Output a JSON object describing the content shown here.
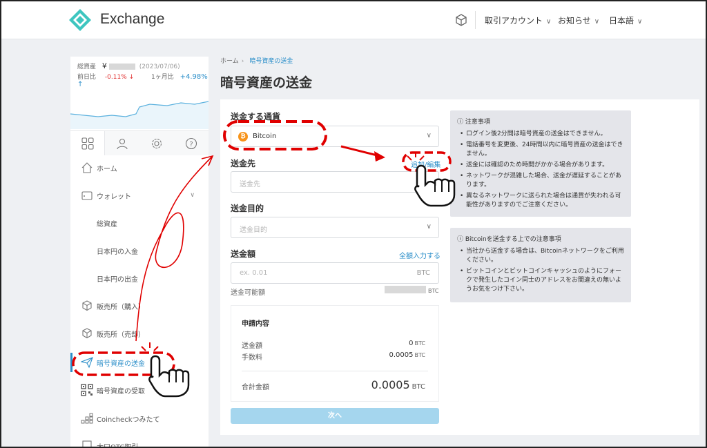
{
  "header": {
    "app_name": "Exchange",
    "menu": [
      {
        "label": "取引アカウント"
      },
      {
        "label": "お知らせ"
      },
      {
        "label": "日本語"
      }
    ],
    "brand_color": "#3fc6c0"
  },
  "sidebar": {
    "balance_label": "総資産",
    "currency_symbol": "¥",
    "balance_date": "(2023/07/06)",
    "prev_day_label": "前日比",
    "prev_day_value": "-0.11% ↓",
    "month_label": "1ヶ月比",
    "month_value": "+4.98% ↑",
    "items": [
      {
        "label": "ホーム"
      },
      {
        "label": "ウォレット"
      },
      {
        "label": "総資産"
      },
      {
        "label": "日本円の入金"
      },
      {
        "label": "日本円の出金"
      },
      {
        "label": "販売所（購入）"
      },
      {
        "label": "販売所（売却）"
      },
      {
        "label": "暗号資産の送金"
      },
      {
        "label": "暗号資産の受取"
      },
      {
        "label": "Coincheckつみたて"
      },
      {
        "label": "大口OTC取引"
      }
    ]
  },
  "breadcrumb": {
    "home": "ホーム",
    "sep": "›",
    "current": "暗号資産の送金"
  },
  "page_title": "暗号資産の送金",
  "form": {
    "currency_label": "送金する通貨",
    "currency_value": "Bitcoin",
    "dest_label": "送金先",
    "dest_link": "追加/編集",
    "dest_placeholder": "送金先",
    "purpose_label": "送金目的",
    "purpose_placeholder": "送金目的",
    "amount_label": "送金額",
    "amount_link": "全額入力する",
    "amount_placeholder": "ex. 0.01",
    "amount_unit": "BTC",
    "available_label": "送金可能額",
    "available_unit": "BTC"
  },
  "summary": {
    "title": "申請内容",
    "amount_label": "送金額",
    "amount_value": "0",
    "fee_label": "手数料",
    "fee_value": "0.0005",
    "total_label": "合計金額",
    "total_value": "0.0005",
    "unit": "BTC"
  },
  "next_button": "次へ",
  "notice1": {
    "title": "ⓘ 注意事項",
    "items": [
      "ログイン後2分間は暗号資産の送金はできません。",
      "電話番号を変更後、24時間以内に暗号資産の送金はできません。",
      "送金には確認のため時間がかかる場合があります。",
      "ネットワークが混雑した場合、送金が遅延することがあります。",
      "異なるネットワークに送られた場合は通貨が失われる可能性がありますのでご注意ください。"
    ]
  },
  "notice2": {
    "title": "ⓘ Bitcoinを送金する上での注意事項",
    "items": [
      "当社から送金する場合は、Bitcoinネットワークをご利用ください。",
      "ビットコインとビットコインキャッシュのようにフォークで発生したコイン同士のアドレスをお間違えの無いようお気をつけ下さい。"
    ]
  },
  "colors": {
    "accent": "#2a8ec9",
    "annotation": "#e00000"
  }
}
